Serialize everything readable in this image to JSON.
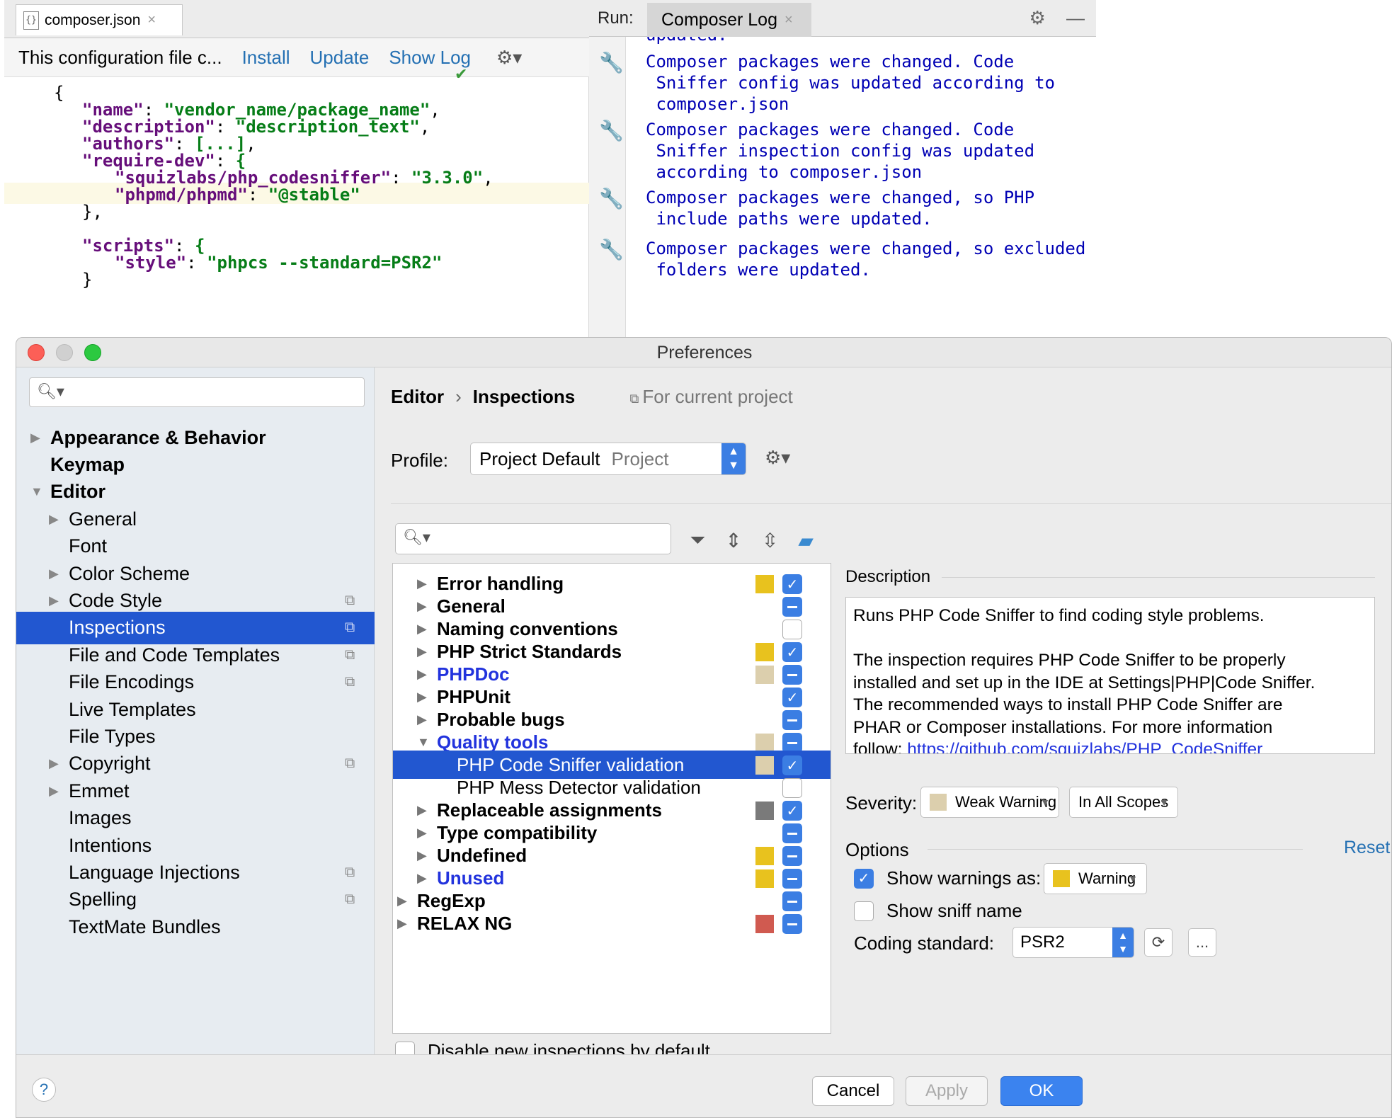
{
  "editor": {
    "tab": {
      "title": "composer.json",
      "icon": "json-file-icon",
      "close": "×"
    },
    "notice": {
      "text": "This configuration file c...",
      "install": "Install",
      "update": "Update",
      "show_log": "Show Log",
      "gear": "⚙▾"
    },
    "code_lines": [
      {
        "t": "{"
      },
      {
        "k": "\"name\"",
        "s": "\"vendor_name/package_name\"",
        "end": ","
      },
      {
        "k": "\"description\"",
        "s": "\"description_text\"",
        "end": ","
      },
      {
        "k": "\"authors\"",
        "s": "[...]",
        "end": ","
      },
      {
        "k": "\"require-dev\"",
        "s": "{",
        "end": ""
      },
      {
        "k": "\"squizlabs/php_codesniffer\"",
        "s": "\"3.3.0\"",
        "end": ","
      },
      {
        "k": "\"phpmd/phpmd\"",
        "s": "\"@stable\"",
        "end": ""
      },
      {
        "t": "},"
      },
      {
        "t": ""
      },
      {
        "k": "\"scripts\"",
        "s": "{",
        "end": ""
      },
      {
        "k": "\"style\"",
        "s": "\"phpcs --standard=PSR2\"",
        "end": ""
      },
      {
        "t": "}"
      }
    ]
  },
  "run": {
    "label": "Run:",
    "tab": "Composer Log",
    "close": "×",
    "log": [
      "updated.",
      "Composer packages were changed. Code\n Sniffer config was updated according to\n composer.json",
      "Composer packages were changed. Code\n Sniffer inspection config was updated\n according to composer.json",
      "Composer packages were changed, so PHP\n include paths were updated.",
      "Composer packages were changed, so excluded\n folders were updated."
    ]
  },
  "prefs": {
    "title": "Preferences",
    "nav": [
      {
        "label": "Appearance & Behavior",
        "level": 0,
        "arrow": "right",
        "bold": true
      },
      {
        "label": "Keymap",
        "level": 0,
        "arrow": "",
        "bold": true
      },
      {
        "label": "Editor",
        "level": 0,
        "arrow": "down",
        "bold": true
      },
      {
        "label": "General",
        "level": 1,
        "arrow": "right"
      },
      {
        "label": "Font",
        "level": 1,
        "arrow": ""
      },
      {
        "label": "Color Scheme",
        "level": 1,
        "arrow": "right"
      },
      {
        "label": "Code Style",
        "level": 1,
        "arrow": "right",
        "copy": true
      },
      {
        "label": "Inspections",
        "level": 1,
        "arrow": "",
        "copy": true,
        "selected": true
      },
      {
        "label": "File and Code Templates",
        "level": 1,
        "arrow": "",
        "copy": true
      },
      {
        "label": "File Encodings",
        "level": 1,
        "arrow": "",
        "copy": true
      },
      {
        "label": "Live Templates",
        "level": 1,
        "arrow": ""
      },
      {
        "label": "File Types",
        "level": 1,
        "arrow": ""
      },
      {
        "label": "Copyright",
        "level": 1,
        "arrow": "right",
        "copy": true
      },
      {
        "label": "Emmet",
        "level": 1,
        "arrow": "right"
      },
      {
        "label": "Images",
        "level": 1,
        "arrow": ""
      },
      {
        "label": "Intentions",
        "level": 1,
        "arrow": ""
      },
      {
        "label": "Language Injections",
        "level": 1,
        "arrow": "",
        "copy": true
      },
      {
        "label": "Spelling",
        "level": 1,
        "arrow": "",
        "copy": true
      },
      {
        "label": "TextMate Bundles",
        "level": 1,
        "arrow": ""
      }
    ],
    "breadcrumb": {
      "editor": "Editor",
      "sep": "›",
      "current": "Inspections",
      "scope": "For current project"
    },
    "profile": {
      "label": "Profile:",
      "value": "Project Default",
      "scope": "Project"
    },
    "tree": [
      {
        "label": "Error handling",
        "level": 1,
        "arrow": "right",
        "bold": true,
        "swatch": "#e8c21e",
        "check": "on"
      },
      {
        "label": "General",
        "level": 1,
        "arrow": "right",
        "bold": true,
        "swatch": "",
        "check": "mix"
      },
      {
        "label": "Naming conventions",
        "level": 1,
        "arrow": "right",
        "bold": true,
        "swatch": "",
        "check": "off"
      },
      {
        "label": "PHP Strict Standards",
        "level": 1,
        "arrow": "right",
        "bold": true,
        "swatch": "#e8c21e",
        "check": "on"
      },
      {
        "label": "PHPDoc",
        "level": 1,
        "arrow": "right",
        "bold": true,
        "blue": true,
        "swatch": "#dccfad",
        "check": "mix"
      },
      {
        "label": "PHPUnit",
        "level": 1,
        "arrow": "right",
        "bold": true,
        "swatch": "",
        "check": "on"
      },
      {
        "label": "Probable bugs",
        "level": 1,
        "arrow": "right",
        "bold": true,
        "swatch": "",
        "check": "mix"
      },
      {
        "label": "Quality tools",
        "level": 1,
        "arrow": "down",
        "bold": true,
        "blue": true,
        "swatch": "#dccfad",
        "check": "mix"
      },
      {
        "label": "PHP Code Sniffer validation",
        "level": 2,
        "arrow": "",
        "swatch": "#dccfad",
        "check": "on",
        "selected": true
      },
      {
        "label": "PHP Mess Detector validation",
        "level": 2,
        "arrow": "",
        "swatch": "",
        "check": "off"
      },
      {
        "label": "Replaceable assignments",
        "level": 1,
        "arrow": "right",
        "bold": true,
        "swatch": "#7a7a7a",
        "check": "on"
      },
      {
        "label": "Type compatibility",
        "level": 1,
        "arrow": "right",
        "bold": true,
        "swatch": "",
        "check": "mix"
      },
      {
        "label": "Undefined",
        "level": 1,
        "arrow": "right",
        "bold": true,
        "swatch": "#e8c21e",
        "check": "mix"
      },
      {
        "label": "Unused",
        "level": 1,
        "arrow": "right",
        "bold": true,
        "blue": true,
        "swatch": "#e8c21e",
        "check": "mix"
      },
      {
        "label": "RegExp",
        "level": 0,
        "arrow": "right",
        "bold": true,
        "swatch": "",
        "check": "mix"
      },
      {
        "label": "RELAX NG",
        "level": 0,
        "arrow": "right",
        "bold": true,
        "swatch": "#d05a50",
        "check": "mix"
      }
    ],
    "disable_new": "Disable new inspections by default",
    "description": {
      "label": "Description",
      "text_a": "Runs PHP Code Sniffer to find coding style problems.\n\nThe inspection requires PHP Code Sniffer to be properly\ninstalled and set up in the IDE at Settings|PHP|Code Sniffer.\nThe recommended ways to install PHP Code Sniffer are\nPHAR or Composer installations. For more information\nfollow: ",
      "link": "https://github.com/squizlabs/PHP_CodeSniffer"
    },
    "severity": {
      "label": "Severity:",
      "value": "Weak Warning",
      "swatch": "#dccfad",
      "scope": "In All Scopes"
    },
    "options": {
      "label": "Options",
      "reset": "Reset",
      "show_warnings": "Show warnings as:",
      "warning_value": "Warning",
      "warning_swatch": "#e8c21e",
      "show_sniff": "Show sniff name",
      "coding_label": "Coding standard:",
      "coding_value": "PSR2",
      "more": "..."
    },
    "footer": {
      "help": "?",
      "cancel": "Cancel",
      "apply": "Apply",
      "ok": "OK"
    }
  }
}
